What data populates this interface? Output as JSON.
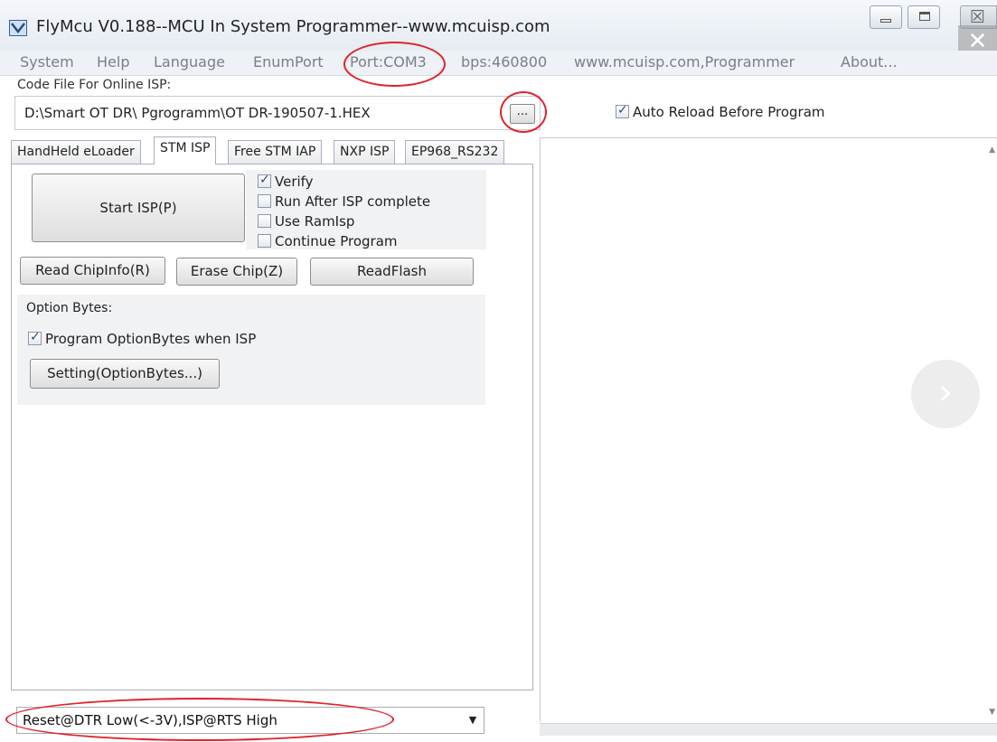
{
  "window": {
    "title": "FlyMcu V0.188--MCU In System Programmer--www.mcuisp.com",
    "close_glyph": "✕",
    "icons": [
      "app-icon",
      "minimize-icon",
      "maximize-icon",
      "close-icon"
    ]
  },
  "menu": {
    "items": [
      "System",
      "Help",
      "Language",
      "EnumPort",
      "Port:COM3",
      "bps:460800",
      "www.mcuisp.com,Programmer",
      "About..."
    ]
  },
  "code_file": {
    "label": "Code File For Online ISP:",
    "path": "D:\\Smart OT DR\\ Pgrogramm\\OT DR-190507-1.HEX",
    "browse_label": "...",
    "auto_reload_label": "Auto Reload Before Program",
    "auto_reload_checked": true
  },
  "tabs": [
    "HandHeld eLoader",
    "STM ISP",
    "Free STM IAP",
    "NXP ISP",
    "EP968_RS232"
  ],
  "active_tab": "STM ISP",
  "stm_isp": {
    "start_button": "Start ISP(P)",
    "options": [
      {
        "label": "Verify",
        "checked": true
      },
      {
        "label": "Run After ISP complete",
        "checked": false
      },
      {
        "label": "Use RamIsp",
        "checked": false
      },
      {
        "label": "Continue Program",
        "checked": false
      }
    ],
    "buttons": {
      "read_chipinfo": "Read ChipInfo(R)",
      "erase_chip": "Erase Chip(Z)",
      "read_flash": "ReadFlash"
    },
    "option_bytes": {
      "title": "Option Bytes:",
      "program_label": "Program OptionBytes when ISP",
      "program_checked": true,
      "setting_button": "Setting(OptionBytes...)"
    }
  },
  "reset_mode": {
    "selected": "Reset@DTR Low(<-3V),ISP@RTS High",
    "arrow": "▼"
  },
  "overlay": {
    "next_glyph": "›"
  },
  "annotation_color": "#e0232a"
}
